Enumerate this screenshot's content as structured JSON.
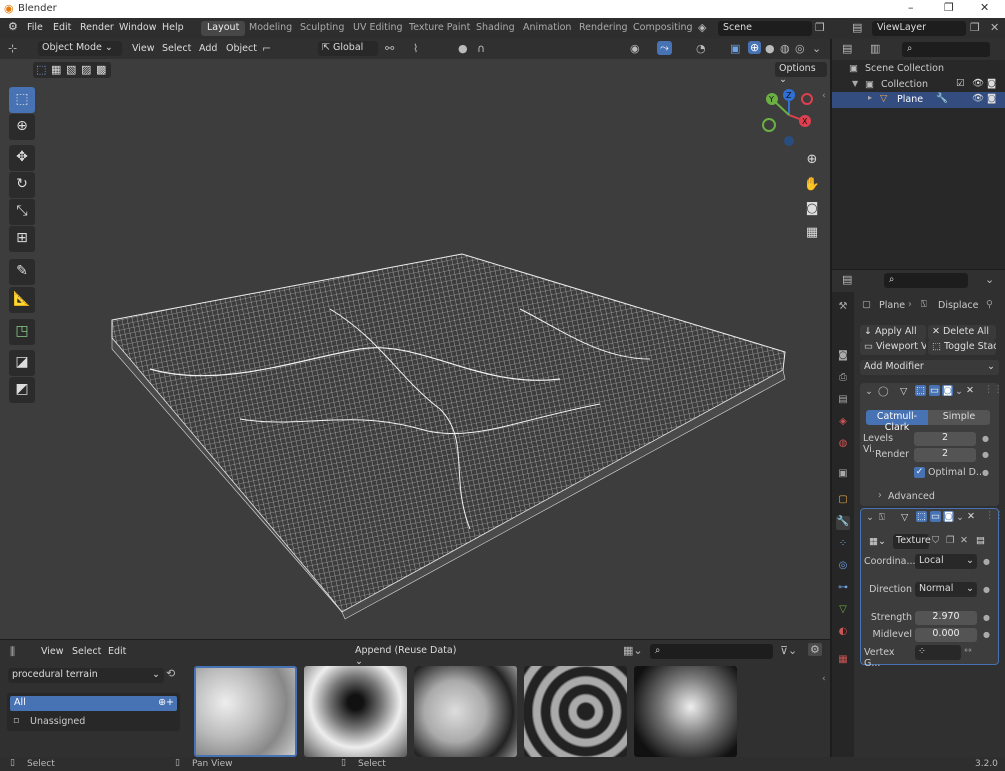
{
  "titlebar": {
    "title": "Blender",
    "minimize": "–",
    "maximize": "❐",
    "close": "✕"
  },
  "menu": [
    "File",
    "Edit",
    "Render",
    "Window",
    "Help"
  ],
  "workspaces": [
    "Layout",
    "Modeling",
    "Sculpting",
    "UV Editing",
    "Texture Paint",
    "Shading",
    "Animation",
    "Rendering",
    "Compositing"
  ],
  "scene": "Scene",
  "viewlayer": "ViewLayer",
  "viewport": {
    "mode": "Object Mode",
    "menus": [
      "View",
      "Select",
      "Add",
      "Object"
    ],
    "orientation": "Global",
    "options": "Options",
    "gizmo": {
      "x": "X",
      "y": "Y",
      "z": "Z"
    }
  },
  "outliner": {
    "root": "Scene Collection",
    "collection": "Collection",
    "object": "Plane"
  },
  "props": {
    "crumb_obj": "Plane",
    "crumb_mod": "Displace",
    "apply_all": "Apply All",
    "delete_all": "Delete All",
    "viewport_vis": "Viewport Vis",
    "toggle_stack": "Toggle Stack",
    "add_modifier": "Add Modifier",
    "subsurf": {
      "catmull": "Catmull-Clark",
      "simple": "Simple",
      "levels_label": "Levels Vi...",
      "levels": "2",
      "render_label": "Render",
      "render": "2",
      "optimal": "Optimal D...",
      "advanced": "Advanced"
    },
    "displace": {
      "texture": "Texture",
      "coord_label": "Coordina...",
      "coord": "Local",
      "dir_label": "Direction",
      "dir": "Normal",
      "strength_label": "Strength",
      "strength": "2.970",
      "midlevel_label": "Midlevel",
      "midlevel": "0.000",
      "vgroup_label": "Vertex G..."
    }
  },
  "browser": {
    "menus": [
      "View",
      "Select",
      "Edit"
    ],
    "import": "Append (Reuse Data)",
    "library": "procedural terrain",
    "cat_all": "All",
    "cat_unassigned": "Unassigned"
  },
  "status": {
    "select": "Select",
    "pan": "Pan View",
    "select2": "Select",
    "version": "3.2.0"
  }
}
